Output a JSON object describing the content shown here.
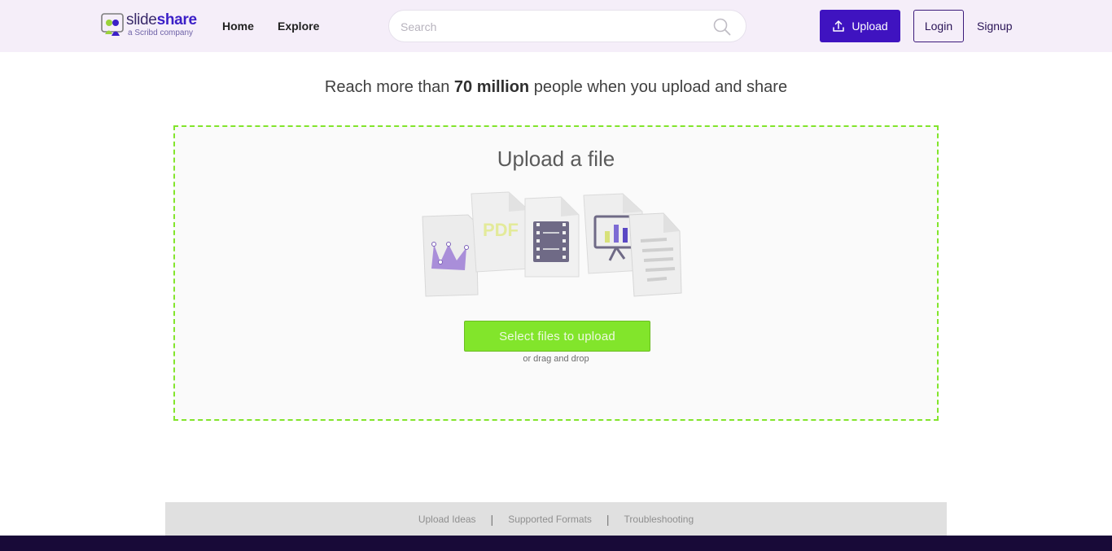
{
  "brand": {
    "name_light": "slide",
    "name_bold": "share",
    "tagline": "a Scribd company"
  },
  "nav": {
    "home": "Home",
    "explore": "Explore"
  },
  "search": {
    "placeholder": "Search",
    "value": ""
  },
  "header_actions": {
    "upload": "Upload",
    "login": "Login",
    "signup": "Signup"
  },
  "headline": {
    "before": "Reach more than ",
    "highlight": "70 million",
    "after": " people when you upload and share"
  },
  "upload": {
    "title": "Upload a file",
    "illustration_labels": {
      "pdf": "PDF"
    },
    "select_button": "Select files to upload",
    "hint": "or drag and drop"
  },
  "footer": {
    "links": [
      "Upload Ideas",
      "Supported Formats",
      "Troubleshooting"
    ]
  },
  "colors": {
    "brand_purple": "#3f13c0",
    "accent_green": "#82e52b",
    "header_bg": "#f5eef9",
    "bottom_bar": "#180a38"
  }
}
